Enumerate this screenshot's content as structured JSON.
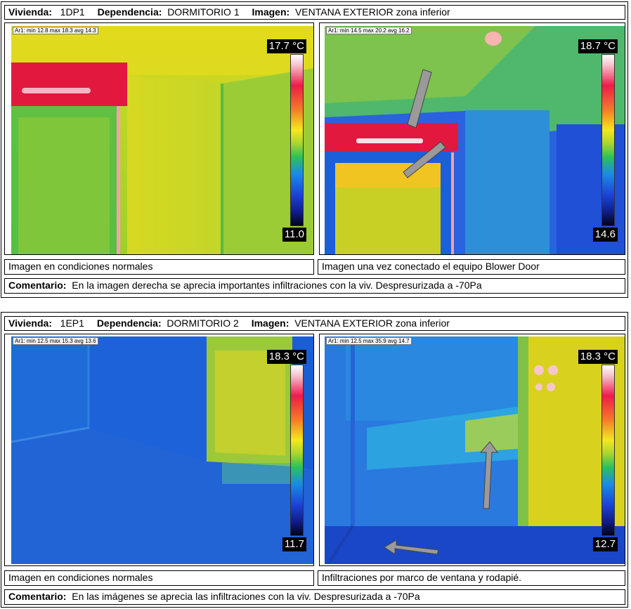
{
  "labels": {
    "vivienda": "Vivienda:",
    "dependencia": "Dependencia:",
    "imagen": "Imagen:",
    "comentario": "Comentario:"
  },
  "sections": [
    {
      "vivienda": "1DP1",
      "dependencia": "DORMITORIO 1",
      "imagen": "VENTANA EXTERIOR zona inferior",
      "left": {
        "stats": "Ar1: min 12.8 max 18.3 avg 14.3",
        "scale_max": "17.7 °C",
        "scale_min": "11.0",
        "caption": "Imagen en condiciones normales"
      },
      "right": {
        "stats": "Ar1: min 14.5 max 20.2 avg 16.2",
        "scale_max": "18.7 °C",
        "scale_min": "14.6",
        "caption": "Imagen una vez conectado el equipo Blower Door"
      },
      "comentario": "En la imagen derecha se aprecia importantes infiltraciones con la viv. Despresurizada a -70Pa"
    },
    {
      "vivienda": "1EP1",
      "dependencia": "DORMITORIO 2",
      "imagen": "VENTANA EXTERIOR zona inferior",
      "left": {
        "stats": "Ar1: min 12.5 max 15.3 avg 13.6",
        "scale_max": "18.3 °C",
        "scale_min": "11.7",
        "caption": "Imagen en condiciones normales"
      },
      "right": {
        "stats": "Ar1: min 12.5 max 35.9 avg 14.7",
        "scale_max": "18.3 °C",
        "scale_min": "12.7",
        "caption": "Infiltraciones por marco de ventana y rodapié."
      },
      "comentario": "En las imágenes se aprecia las infiltraciones con la viv. Despresurizada a -70Pa"
    }
  ]
}
